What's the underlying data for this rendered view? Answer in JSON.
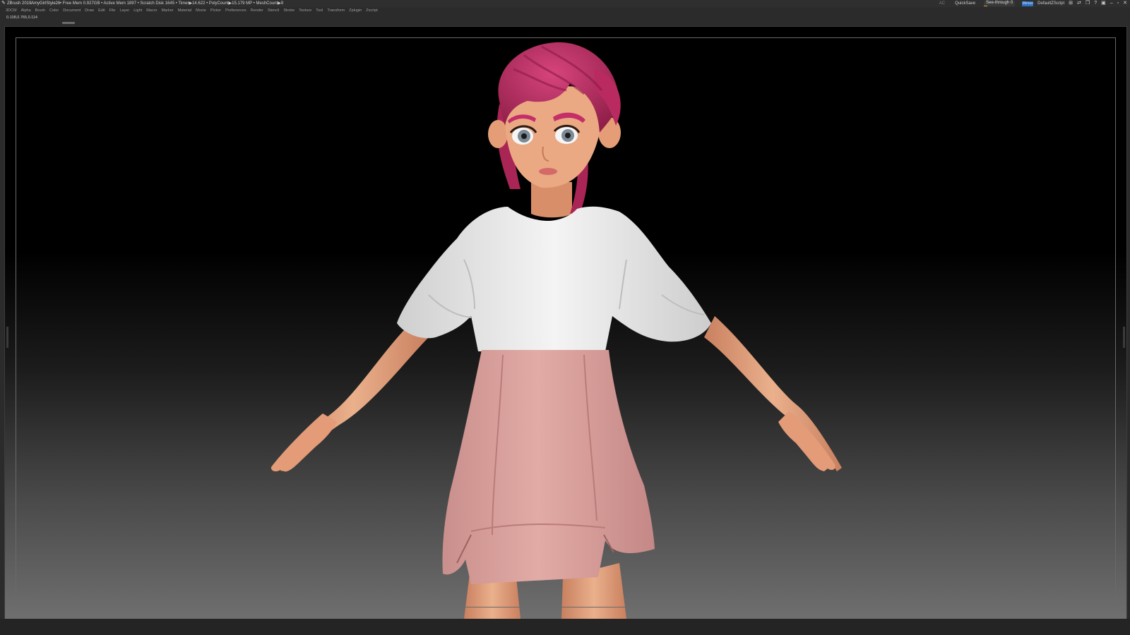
{
  "titlebar": {
    "app_name": "ZBrush 2019",
    "document_name": "AmyGirlStyle26",
    "stats": "• Free Mem 0.927GB • Active Mem 1897 • Scratch Disk 1645 • Timer▶14.622 • PolyCount▶15.179 MP • MeshCount▶9",
    "ac_label": "AC",
    "quicksave_label": "QuickSave",
    "seethrough_label": "See-through 0",
    "seethrough_value": 0,
    "menus_label": "Menus",
    "script_label": "DefaultZScript"
  },
  "menubar": {
    "items": [
      "3DCM",
      "Alpha",
      "Brush",
      "Color",
      "Document",
      "Draw",
      "Edit",
      "File",
      "Layer",
      "Light",
      "Macro",
      "Marker",
      "Material",
      "Movie",
      "Picker",
      "Preferences",
      "Render",
      "Stencil",
      "Stroke",
      "Texture",
      "Tool",
      "Transform",
      "Zplugin",
      "Zscript"
    ]
  },
  "infobar": {
    "coords": "0.108,0.765,0.114"
  },
  "colors": {
    "hair": "#c42f68",
    "skin": "#e8a37e",
    "shirt": "#eeeeee",
    "skirt": "#dca29e",
    "menus_accent": "#2d6fc0",
    "seethrough_accent": "#d9a030"
  }
}
